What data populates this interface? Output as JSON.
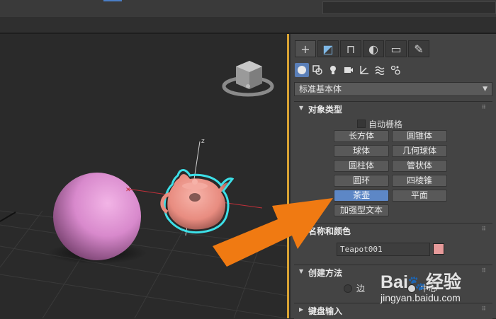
{
  "top_bar": {},
  "command_panel": {
    "tabs": [
      {
        "icon": "create-plus-icon",
        "glyph": "+"
      },
      {
        "icon": "modify-icon",
        "glyph": "◩"
      },
      {
        "icon": "hierarchy-icon",
        "glyph": "⊓"
      },
      {
        "icon": "motion-icon",
        "glyph": "◐"
      },
      {
        "icon": "display-icon",
        "glyph": "▭"
      },
      {
        "icon": "utilities-wrench-icon",
        "glyph": "✎"
      }
    ],
    "category_icons": [
      "geometry-icon",
      "shapes-icon",
      "lights-icon",
      "cameras-icon",
      "helpers-icon",
      "space-warps-icon",
      "systems-icon"
    ],
    "category_dropdown": "标准基本体",
    "object_type": {
      "title": "对象类型",
      "autogrid_label": "自动栅格",
      "buttons": [
        "长方体",
        "圆锥体",
        "球体",
        "几何球体",
        "圆柱体",
        "管状体",
        "圆环",
        "四棱锥",
        "茶壶",
        "平面",
        "加强型文本"
      ],
      "active": "茶壶"
    },
    "name_color": {
      "title": "名称和颜色",
      "name_value": "Teapot001",
      "swatch_color": "#e69a9a"
    },
    "creation_method": {
      "title": "创建方法",
      "option_edge": "边",
      "option_center": "中心"
    },
    "keyboard_entry": {
      "title": "键盘输入"
    }
  },
  "viewport": {
    "objects": [
      "sphere",
      "teapot"
    ],
    "selected": "teapot",
    "axis_label_z": "z"
  },
  "watermark": {
    "logo": "Bai",
    "logo_rest": "经验",
    "url": "jingyan.baidu.com"
  },
  "colors": {
    "accent_blue": "#5d87c6",
    "selection_cyan": "#3de0e8",
    "arrow_orange": "#f07a12",
    "viewport_border": "#d7a233"
  }
}
